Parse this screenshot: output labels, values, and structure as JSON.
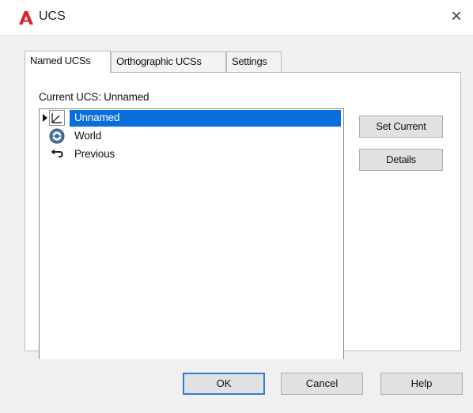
{
  "window": {
    "title": "UCS",
    "close_glyph": "×",
    "logo_icon": "autocad-logo",
    "accent_color": "#d7282f"
  },
  "tabs": [
    {
      "label": "Named UCSs",
      "active": true
    },
    {
      "label": "Orthographic UCSs",
      "active": false
    },
    {
      "label": "Settings",
      "active": false
    }
  ],
  "named_ucs": {
    "current_label": "Current UCS:  Unnamed",
    "list": [
      {
        "label": "Unnamed",
        "icon": "ucs-axis-icon",
        "selected": true,
        "current": true
      },
      {
        "label": "World",
        "icon": "globe-icon",
        "selected": false,
        "current": false
      },
      {
        "label": "Previous",
        "icon": "undo-arrow-icon",
        "selected": false,
        "current": false
      }
    ],
    "selection_color": "#0a6ddc",
    "buttons": {
      "set_current": "Set Current",
      "details": "Details"
    }
  },
  "footer": {
    "ok": "OK",
    "cancel": "Cancel",
    "help": "Help"
  }
}
